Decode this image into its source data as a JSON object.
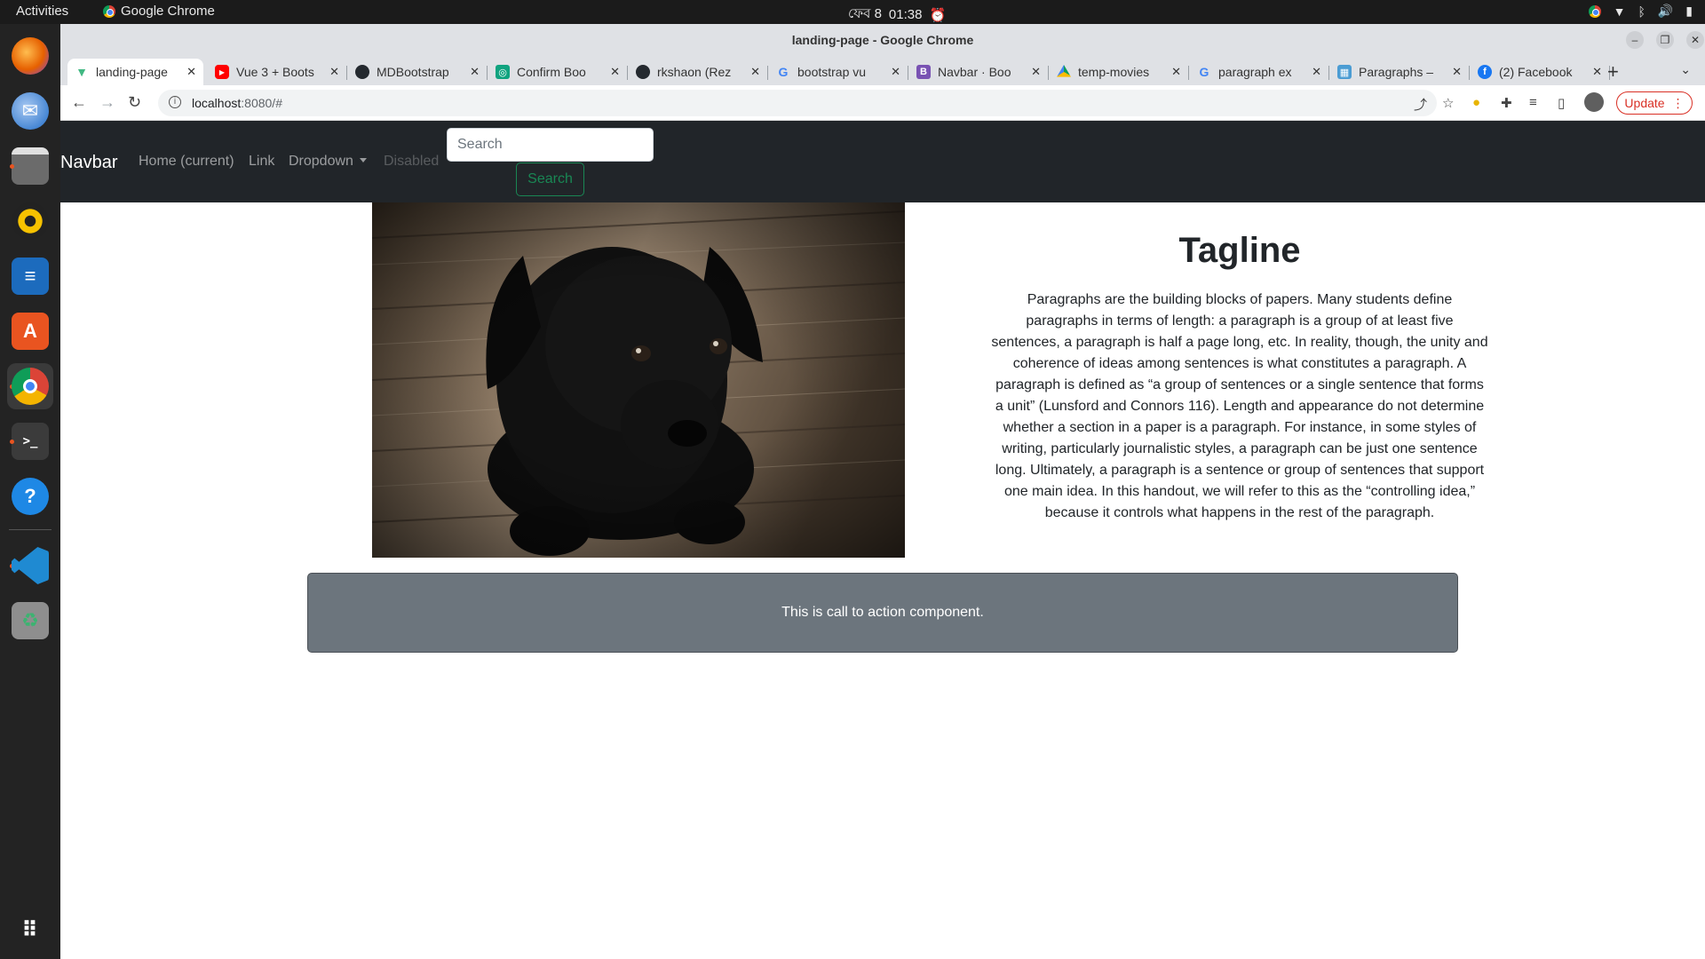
{
  "system": {
    "activities": "Activities",
    "app_name": "Google Chrome",
    "clock_date": "ফেব 8",
    "clock_time": "01:38"
  },
  "dock": {
    "items": [
      "firefox",
      "thunderbird",
      "files",
      "rhythmbox",
      "libreoffice-writer",
      "app-center",
      "chrome",
      "terminal",
      "help",
      "vscode",
      "trash",
      "show-apps"
    ]
  },
  "browser": {
    "window_title": "landing-page - Google Chrome",
    "tabs": [
      {
        "label": "landing-page",
        "favicon": "vue"
      },
      {
        "label": "Vue 3 + Boots",
        "favicon": "youtube"
      },
      {
        "label": "MDBootstrap",
        "favicon": "github"
      },
      {
        "label": "Confirm Boo",
        "favicon": "openai"
      },
      {
        "label": "rkshaon (Rez",
        "favicon": "github"
      },
      {
        "label": "bootstrap vu",
        "favicon": "google"
      },
      {
        "label": "Navbar · Boo",
        "favicon": "bootstrap"
      },
      {
        "label": "temp-movies",
        "favicon": "drive"
      },
      {
        "label": "paragraph ex",
        "favicon": "google"
      },
      {
        "label": "Paragraphs –",
        "favicon": "unc"
      },
      {
        "label": "(2) Facebook",
        "favicon": "facebook"
      }
    ],
    "url_host": "localhost",
    "url_rest": ":8080/#",
    "update_label": "Update"
  },
  "site": {
    "brand": "Navbar",
    "nav": {
      "home": "Home (current)",
      "link": "Link",
      "dropdown": "Dropdown",
      "disabled": "Disabled"
    },
    "search": {
      "placeholder": "Search",
      "button": "Search"
    },
    "tagline": "Tagline",
    "paragraph": "Paragraphs are the building blocks of papers. Many students define paragraphs in terms of length: a paragraph is a group of at least five sentences, a paragraph is half a page long, etc. In reality, though, the unity and coherence of ideas among sentences is what constitutes a paragraph. A paragraph is defined as “a group of sentences or a single sentence that forms a unit” (Lunsford and Connors 116). Length and appearance do not determine whether a section in a paper is a paragraph. For instance, in some styles of writing, particularly journalistic styles, a paragraph can be just one sentence long. Ultimately, a paragraph is a sentence or group of sentences that support one main idea. In this handout, we will refer to this as the “controlling idea,” because it controls what happens in the rest of the paragraph.",
    "cta": "This is call to action component."
  },
  "colors": {
    "navbar_bg": "#212529",
    "cta_bg": "#6c757d",
    "search_btn": "#198754",
    "update": "#d93025"
  }
}
